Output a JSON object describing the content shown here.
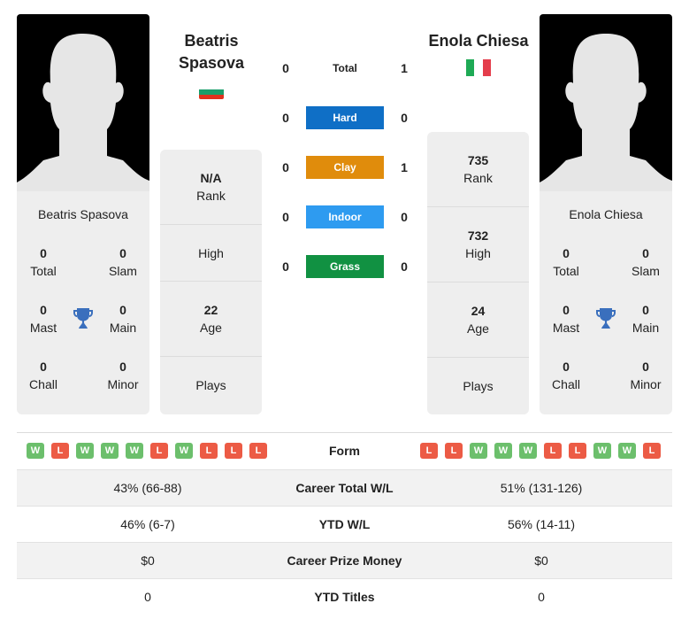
{
  "players": {
    "left": {
      "name": "Beatris Spasova",
      "name_line1": "Beatris",
      "name_line2": "Spasova",
      "country": "Bulgaria",
      "flag_colors": [
        "#ffffff",
        "#1a9e6b",
        "#e0321e"
      ],
      "titles": {
        "total": {
          "value": "0",
          "label": "Total"
        },
        "slam": {
          "value": "0",
          "label": "Slam"
        },
        "mast": {
          "value": "0",
          "label": "Mast"
        },
        "main": {
          "value": "0",
          "label": "Main"
        },
        "chall": {
          "value": "0",
          "label": "Chall"
        },
        "minor": {
          "value": "0",
          "label": "Minor"
        }
      },
      "stats": {
        "rank": {
          "value": "N/A",
          "label": "Rank"
        },
        "high": {
          "value": "",
          "label": "High"
        },
        "age": {
          "value": "22",
          "label": "Age"
        },
        "plays": {
          "value": "",
          "label": "Plays"
        }
      },
      "form": [
        "W",
        "L",
        "W",
        "W",
        "W",
        "L",
        "W",
        "L",
        "L",
        "L"
      ]
    },
    "right": {
      "name": "Enola Chiesa",
      "country": "Italy",
      "flag_colors": [
        "#1eaa55",
        "#ffffff",
        "#e43d4b"
      ],
      "titles": {
        "total": {
          "value": "0",
          "label": "Total"
        },
        "slam": {
          "value": "0",
          "label": "Slam"
        },
        "mast": {
          "value": "0",
          "label": "Mast"
        },
        "main": {
          "value": "0",
          "label": "Main"
        },
        "chall": {
          "value": "0",
          "label": "Chall"
        },
        "minor": {
          "value": "0",
          "label": "Minor"
        }
      },
      "stats": {
        "rank": {
          "value": "735",
          "label": "Rank"
        },
        "high": {
          "value": "732",
          "label": "High"
        },
        "age": {
          "value": "24",
          "label": "Age"
        },
        "plays": {
          "value": "",
          "label": "Plays"
        }
      },
      "form": [
        "L",
        "L",
        "W",
        "W",
        "W",
        "L",
        "L",
        "W",
        "W",
        "L"
      ]
    }
  },
  "h2h": [
    {
      "label": "Total",
      "left": "0",
      "right": "1",
      "color": ""
    },
    {
      "label": "Hard",
      "left": "0",
      "right": "0",
      "color": "#0f6fc6"
    },
    {
      "label": "Clay",
      "left": "0",
      "right": "1",
      "color": "#e08c0c"
    },
    {
      "label": "Indoor",
      "left": "0",
      "right": "0",
      "color": "#2e9bf0"
    },
    {
      "label": "Grass",
      "left": "0",
      "right": "0",
      "color": "#119142"
    }
  ],
  "form_label": "Form",
  "comparison": [
    {
      "label": "Career Total W/L",
      "left": "43% (66-88)",
      "right": "51% (131-126)"
    },
    {
      "label": "YTD W/L",
      "left": "46% (6-7)",
      "right": "56% (14-11)"
    },
    {
      "label": "Career Prize Money",
      "left": "$0",
      "right": "$0"
    },
    {
      "label": "YTD Titles",
      "left": "0",
      "right": "0"
    }
  ],
  "icons": {
    "trophy": "trophy-icon",
    "photo": "player-silhouette"
  },
  "colors": {
    "win": "#6cbf6c",
    "loss": "#ec5b45",
    "trophy": "#3a6fbd",
    "card_bg": "#eeeeee"
  }
}
